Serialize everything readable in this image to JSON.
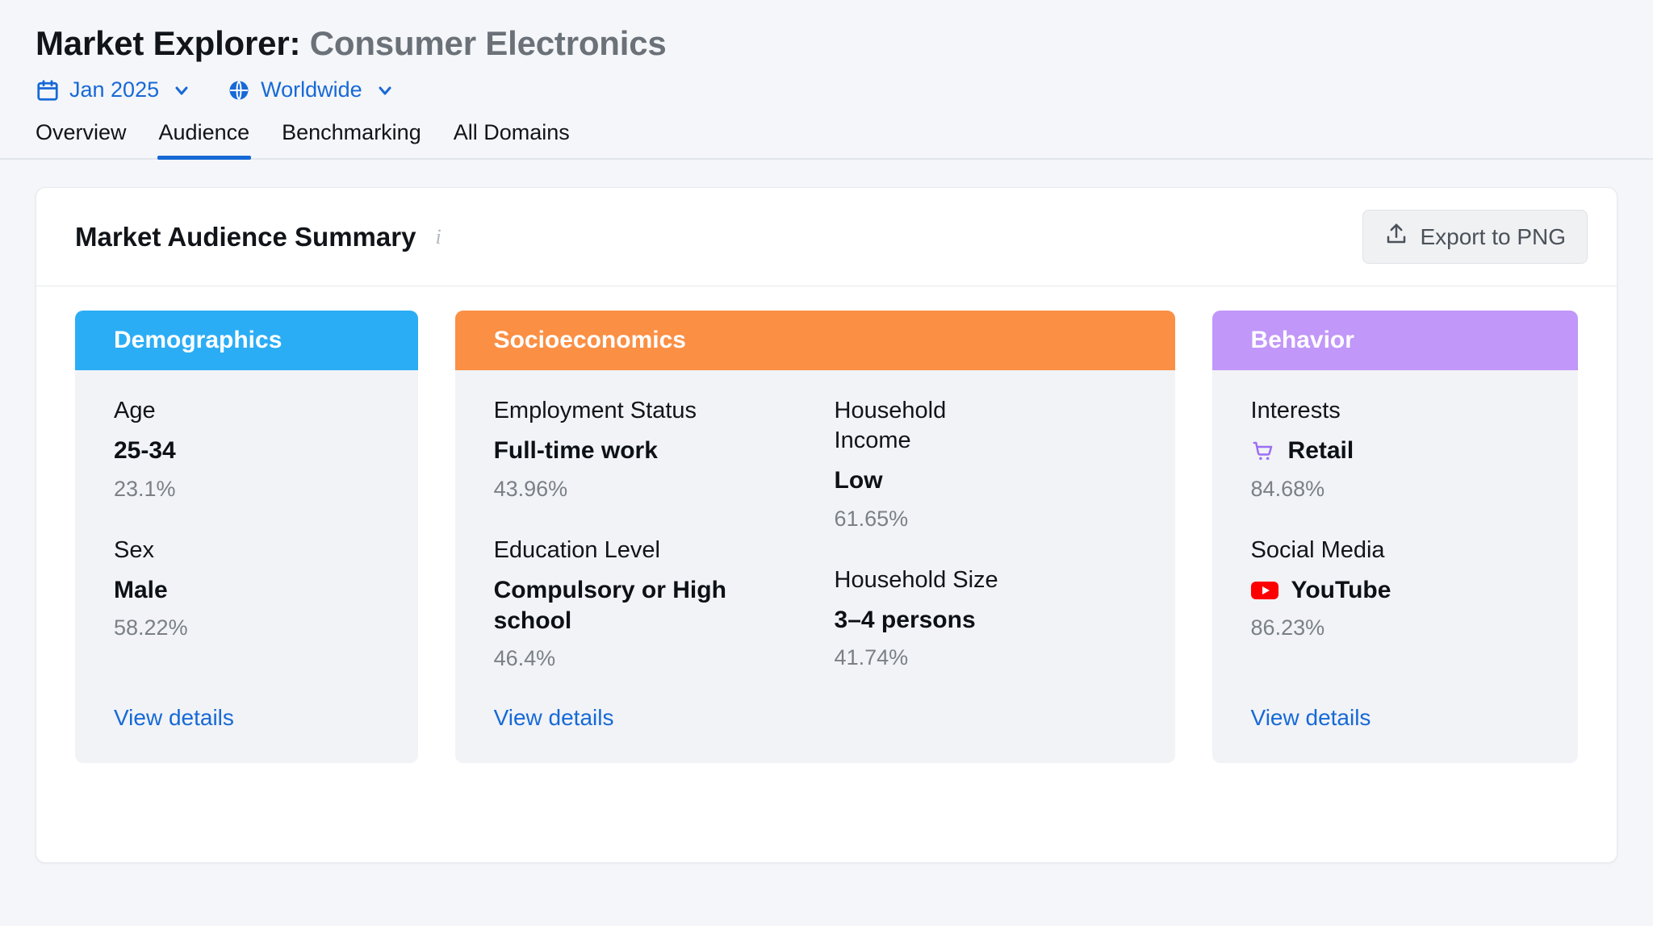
{
  "header": {
    "title_main": "Market Explorer:",
    "title_subject": "Consumer Electronics",
    "filters": [
      {
        "icon": "calendar-icon",
        "label": "Jan 2025"
      },
      {
        "icon": "globe-icon",
        "label": "Worldwide"
      }
    ]
  },
  "tabs": [
    {
      "label": "Overview",
      "active": false
    },
    {
      "label": "Audience",
      "active": true
    },
    {
      "label": "Benchmarking",
      "active": false
    },
    {
      "label": "All Domains",
      "active": false
    }
  ],
  "card": {
    "title": "Market Audience Summary",
    "info_icon": "i",
    "export_button": "Export to PNG",
    "export_icon": "export-upload-icon"
  },
  "panels": [
    {
      "key": "demographics",
      "title": "Demographics",
      "color": "#2BADF5",
      "columns": [
        {
          "metrics": [
            {
              "label": "Age",
              "value": "25-34",
              "pct": "23.1%",
              "icon": null
            },
            {
              "label": "Sex",
              "value": "Male",
              "pct": "58.22%",
              "icon": null
            }
          ]
        }
      ],
      "view_details": "View details"
    },
    {
      "key": "socioeconomics",
      "title": "Socioeconomics",
      "color": "#FB8F44",
      "columns": [
        {
          "metrics": [
            {
              "label": "Employment Status",
              "value": "Full-time work",
              "pct": "43.96%",
              "icon": null
            },
            {
              "label": "Education Level",
              "value": "Compulsory or High school",
              "pct": "46.4%",
              "icon": null
            }
          ]
        },
        {
          "metrics": [
            {
              "label": "Household Income",
              "value": "Low",
              "pct": "61.65%",
              "icon": null
            },
            {
              "label": "Household Size",
              "value": "3–4 persons",
              "pct": "41.74%",
              "icon": null
            }
          ]
        }
      ],
      "view_details": "View details"
    },
    {
      "key": "behavior",
      "title": "Behavior",
      "color": "#C197F9",
      "columns": [
        {
          "metrics": [
            {
              "label": "Interests",
              "value": "Retail",
              "pct": "84.68%",
              "icon": "shopping-cart-icon"
            },
            {
              "label": "Social Media",
              "value": "YouTube",
              "pct": "86.23%",
              "icon": "youtube-icon"
            }
          ]
        }
      ],
      "view_details": "View details"
    }
  ],
  "colors": {
    "link": "#1769d6",
    "demographics": "#2BADF5",
    "socioeconomics": "#FB8F44",
    "behavior": "#C197F9",
    "youtube_red": "#FF0000",
    "cart_purple": "#9B6EF3"
  }
}
